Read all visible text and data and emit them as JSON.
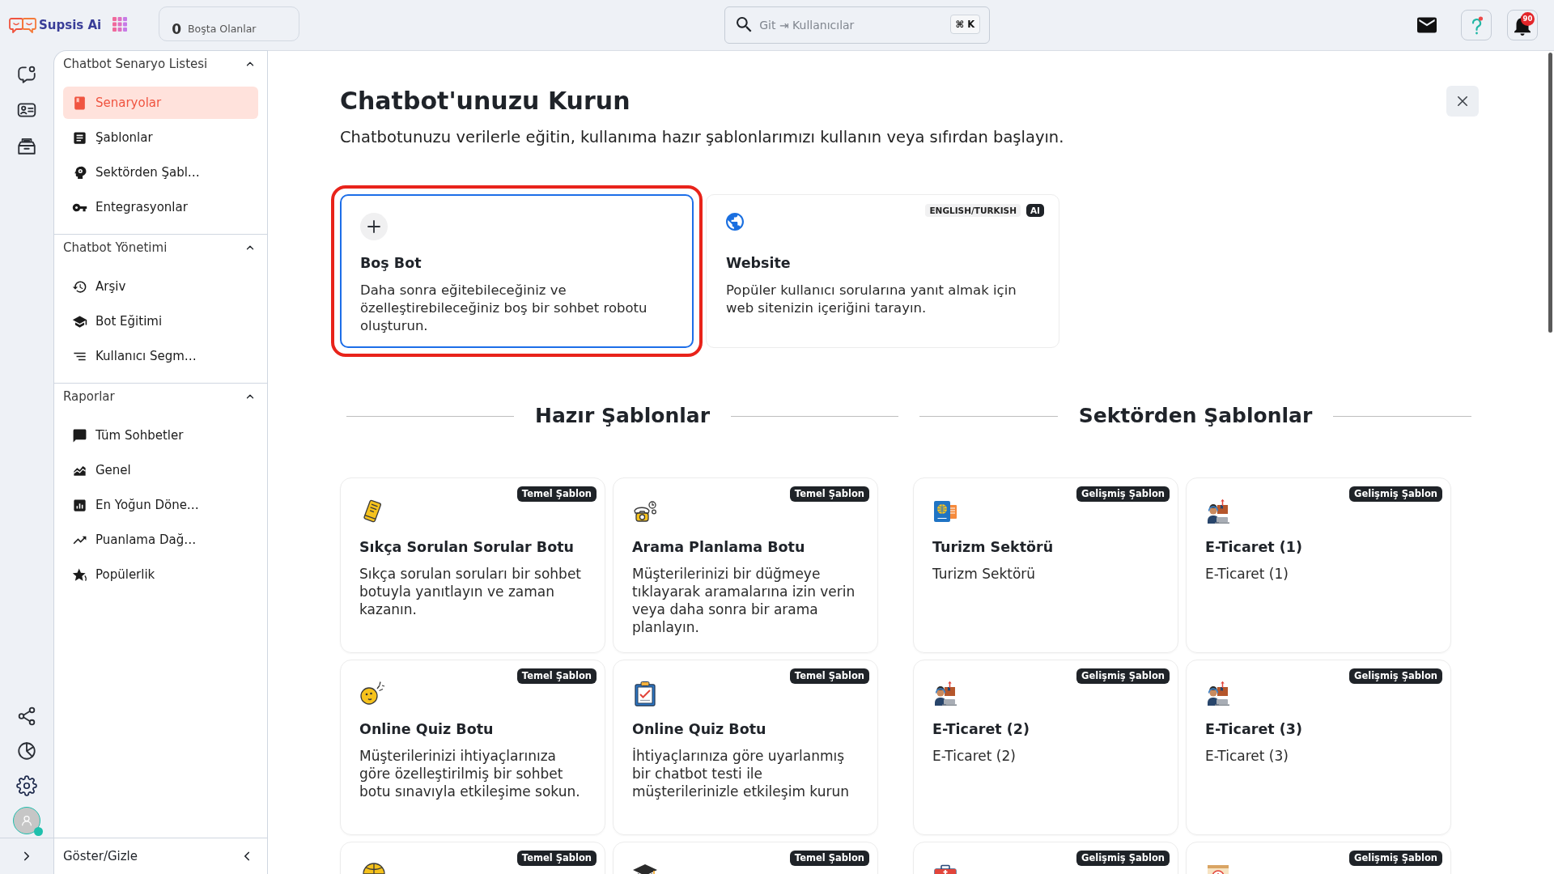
{
  "topbar": {
    "brand": "Supsis Ai",
    "idle": {
      "count": "0",
      "label": "Boşta Olanlar"
    },
    "search": {
      "placeholder": "Git ⇥ Kullanıcılar",
      "shortcut": "⌘ K"
    },
    "notifications": {
      "count": "90"
    }
  },
  "user": {
    "online": true
  },
  "sidebar": {
    "sections": [
      {
        "title": "Chatbot Senaryo Listesi",
        "expanded": true,
        "items": [
          {
            "label": "Senaryolar",
            "selected": true
          },
          {
            "label": "Şablonlar",
            "selected": false
          },
          {
            "label": "Sektörden Şabl…",
            "selected": false
          },
          {
            "label": "Entegrasyonlar",
            "selected": false
          }
        ]
      },
      {
        "title": "Chatbot Yönetimi",
        "expanded": true,
        "items": [
          {
            "label": "Arşiv",
            "selected": false
          },
          {
            "label": "Bot Eğitimi",
            "selected": false
          },
          {
            "label": "Kullanıcı Segm…",
            "selected": false
          }
        ]
      },
      {
        "title": "Raporlar",
        "expanded": true,
        "items": [
          {
            "label": "Tüm Sohbetler",
            "selected": false
          },
          {
            "label": "Genel",
            "selected": false
          },
          {
            "label": "En Yoğun Döne…",
            "selected": false
          },
          {
            "label": "Puanlama Dağ…",
            "selected": false
          },
          {
            "label": "Popülerlik",
            "selected": false
          }
        ]
      }
    ],
    "toggle": "Göster/Gizle"
  },
  "page": {
    "title": "Chatbot'unuzu Kurun",
    "subtitle": "Chatbotunuzu verilerle eğitin, kullanıma hazır şablonlarımızı kullanın veya sıfırdan başlayın."
  },
  "start_options": [
    {
      "title": "Boş Bot",
      "description": "Daha sonra eğitebileceğiniz ve özelleştirebileceğiniz boş bir sohbet robotu oluşturun.",
      "selected": true,
      "highlighted": true
    },
    {
      "title": "Website",
      "description": "Popüler kullanıcı sorularına yanıt almak için web sitenizin içeriğini tarayın.",
      "selected": false,
      "highlighted": false,
      "tags": [
        {
          "label": "ENGLISH/TURKISH",
          "kind": "language"
        },
        {
          "label": "AI",
          "kind": "ai"
        }
      ]
    }
  ],
  "template_groups": [
    {
      "title": "Hazır Şablonlar",
      "templates": [
        {
          "badge": "Temel Şablon",
          "title": "Sıkça Sorulan Sorular Botu",
          "description": "Sıkça sorulan soruları bir sohbet botuyla yanıtlayın ve zaman kazanın."
        },
        {
          "badge": "Temel Şablon",
          "title": "Arama Planlama Botu",
          "description": "Müşterilerinizi bir düğmeye tıklayarak aramalarına izin verin veya daha sonra bir arama planlayın."
        },
        {
          "badge": "Temel Şablon",
          "title": "Online Quiz Botu",
          "description": "Müşterilerinizi ihtiyaçlarınıza göre özelleştirilmiş bir sohbet botu sınavıyla etkileşime sokun."
        },
        {
          "badge": "Temel Şablon",
          "title": "Online Quiz Botu",
          "description": "İhtiyaçlarınıza göre uyarlanmış bir chatbot testi ile müşterilerinizle etkileşim kurun"
        },
        {
          "badge": "Temel Şablon"
        },
        {
          "badge": "Temel Şablon"
        }
      ]
    },
    {
      "title": "Sektörden Şablonlar",
      "templates": [
        {
          "badge": "Gelişmiş Şablon",
          "title": "Turizm Sektörü",
          "description": "Turizm Sektörü"
        },
        {
          "badge": "Gelişmiş Şablon",
          "title": "E-Ticaret (1)",
          "description": "E-Ticaret (1)"
        },
        {
          "badge": "Gelişmiş Şablon",
          "title": "E-Ticaret (2)",
          "description": "E-Ticaret (2)"
        },
        {
          "badge": "Gelişmiş Şablon",
          "title": "E-Ticaret (3)",
          "description": "E-Ticaret (3)"
        },
        {
          "badge": "Gelişmiş Şablon"
        },
        {
          "badge": "Gelişmiş Şablon"
        }
      ]
    }
  ]
}
